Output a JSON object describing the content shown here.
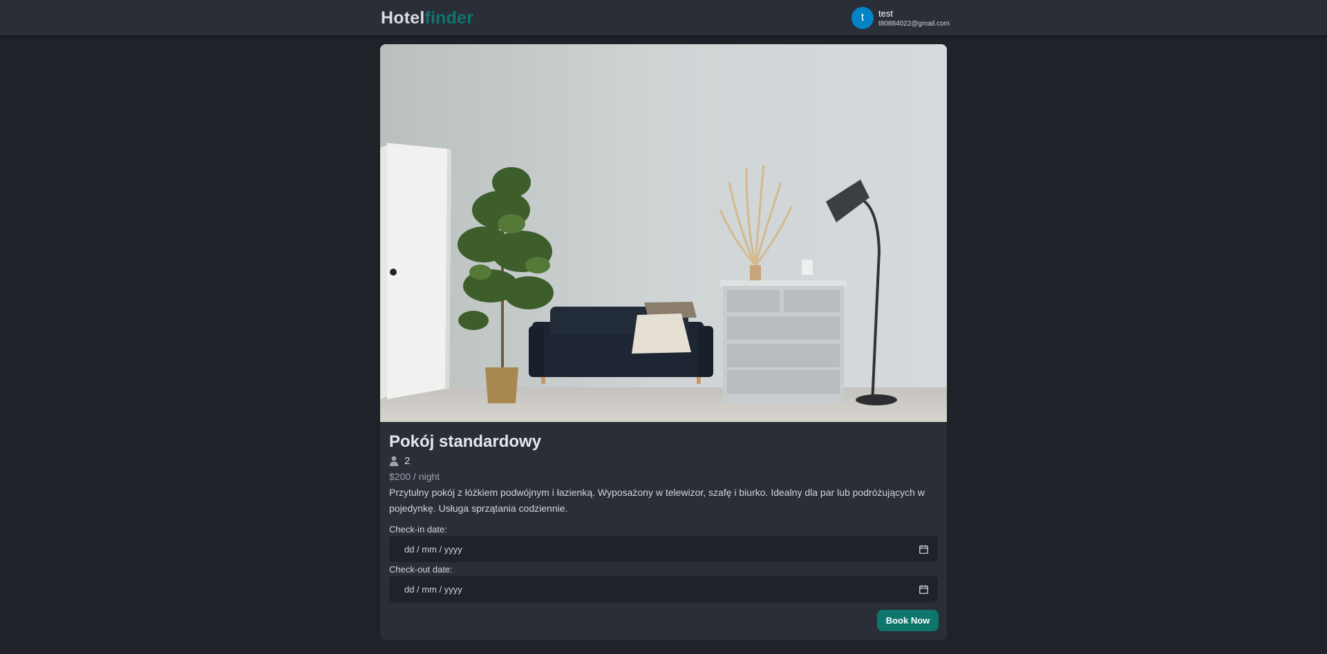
{
  "brand": {
    "part1": "Hotel",
    "part2": "finder"
  },
  "user": {
    "initial": "t",
    "name": "test",
    "email": "t80884022@gmail.com"
  },
  "room": {
    "title": "Pokój standardowy",
    "guests": "2",
    "price": "$200 / night",
    "description": "Przytulny pokój z łóżkiem podwójnym i łazienką. Wyposażony w telewizor, szafę i biurko. Idealny dla par lub podróżujących w pojedynkę. Usługa sprzątania codziennie."
  },
  "booking": {
    "checkin_label": "Check-in date:",
    "checkin_placeholder": "dd / mm / yyyy",
    "checkout_label": "Check-out date:",
    "checkout_placeholder": "dd / mm / yyyy",
    "book_button": "Book Now"
  },
  "icons": {
    "guests": "user-icon",
    "calendar": "calendar-icon"
  },
  "colors": {
    "accent": "#0f766e",
    "avatar": "#0284c7",
    "background": "#1f2229",
    "surface": "#2a2e37"
  }
}
